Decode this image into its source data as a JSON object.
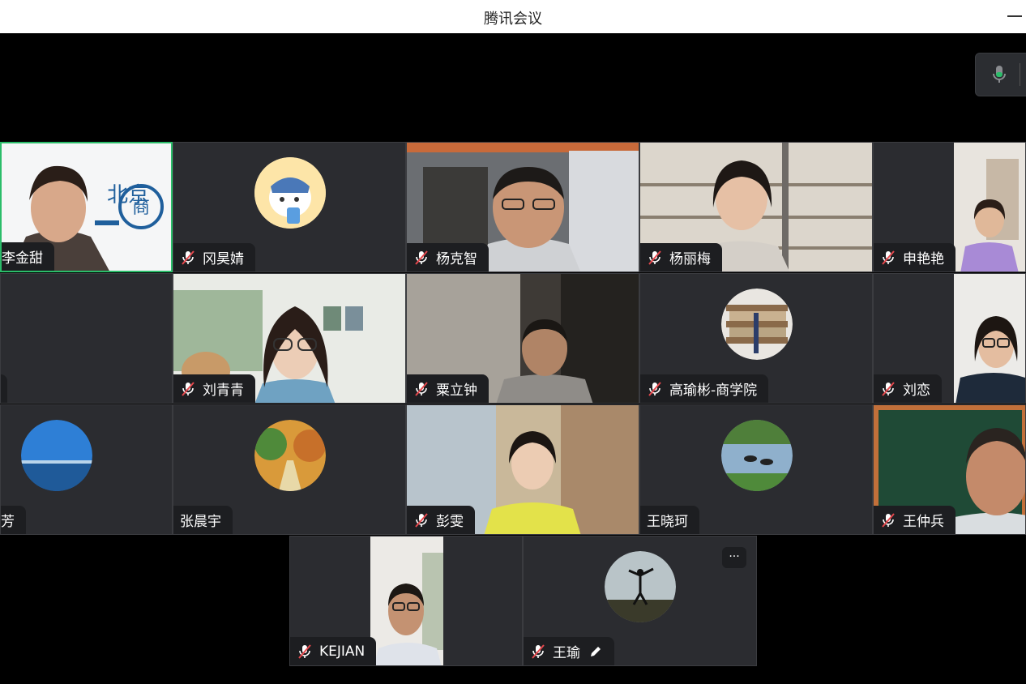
{
  "window": {
    "title": "腾讯会议"
  },
  "participants": {
    "p1": "李金甜",
    "p2": "冈昊婧",
    "p3": "杨克智",
    "p4": "杨丽梅",
    "p5": "申艳艳",
    "p6": "刘青青",
    "p7": "粟立钟",
    "p8": "高瑜彬-商学院",
    "p9": "刘恋",
    "p10": "芳",
    "p11": "张晨宇",
    "p12": "彭雯",
    "p13": "王晓珂",
    "p14": "王仲兵",
    "p15": "KEJIAN",
    "p16": "王瑜"
  },
  "colors": {
    "speaking_border": "#2bbd6a",
    "tile_bg": "#2b2c30",
    "muted_slash": "#e5484d"
  },
  "more_label": "···"
}
